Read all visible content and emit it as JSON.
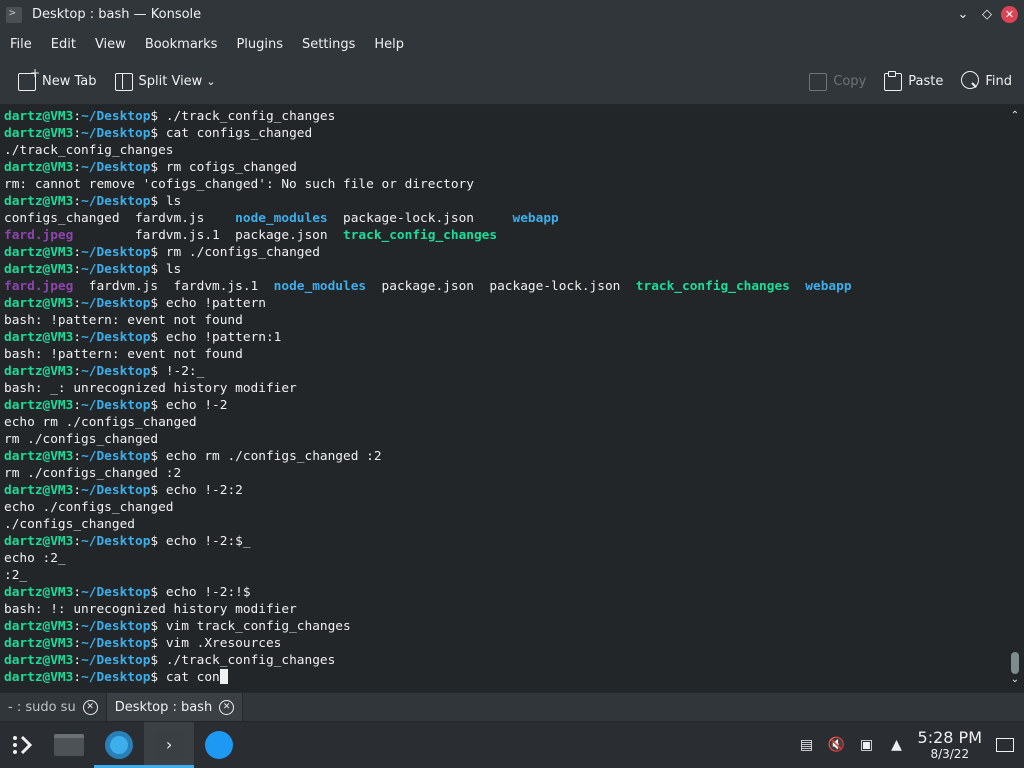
{
  "window": {
    "title": "Desktop : bash — Konsole"
  },
  "menu": [
    "File",
    "Edit",
    "View",
    "Bookmarks",
    "Plugins",
    "Settings",
    "Help"
  ],
  "toolbar": {
    "new_tab": "New Tab",
    "split_view": "Split View",
    "copy": "Copy",
    "paste": "Paste",
    "find": "Find"
  },
  "prompt": {
    "user": "dartz@VM3",
    "path": "~/Desktop"
  },
  "terminal": {
    "lines": [
      {
        "t": "p",
        "cmd": "./track_config_changes"
      },
      {
        "t": "p",
        "cmd": "cat configs_changed"
      },
      {
        "t": "o",
        "text": "./track_config_changes"
      },
      {
        "t": "p",
        "cmd": "rm cofigs_changed"
      },
      {
        "t": "o",
        "text": "rm: cannot remove 'cofigs_changed': No such file or directory"
      },
      {
        "t": "p",
        "cmd": "ls"
      },
      {
        "t": "ls",
        "items": [
          [
            "configs_changed  ",
            ""
          ],
          [
            "fardvm.js    ",
            ""
          ],
          [
            "node_modules",
            "dir"
          ],
          [
            "  package-lock.json     ",
            ""
          ],
          [
            "webapp",
            "dir"
          ]
        ]
      },
      {
        "t": "ls",
        "items": [
          [
            "fard.jpeg",
            "img"
          ],
          [
            "        fardvm.js.1  package.json  ",
            ""
          ],
          [
            "track_config_changes",
            "exe"
          ]
        ]
      },
      {
        "t": "p",
        "cmd": "rm ./configs_changed"
      },
      {
        "t": "p",
        "cmd": "ls"
      },
      {
        "t": "ls",
        "items": [
          [
            "fard.jpeg",
            "img"
          ],
          [
            "  fardvm.js  fardvm.js.1  ",
            ""
          ],
          [
            "node_modules",
            "dir"
          ],
          [
            "  package.json  package-lock.json  ",
            ""
          ],
          [
            "track_config_changes",
            "exe"
          ],
          [
            "  ",
            ""
          ],
          [
            "webapp",
            "dir"
          ]
        ]
      },
      {
        "t": "p",
        "cmd": "echo !pattern"
      },
      {
        "t": "o",
        "text": "bash: !pattern: event not found"
      },
      {
        "t": "p",
        "cmd": "echo !pattern:1"
      },
      {
        "t": "o",
        "text": "bash: !pattern: event not found"
      },
      {
        "t": "p",
        "cmd": "!-2:_"
      },
      {
        "t": "o",
        "text": "bash: _: unrecognized history modifier"
      },
      {
        "t": "p",
        "cmd": "echo !-2"
      },
      {
        "t": "o",
        "text": "echo rm ./configs_changed"
      },
      {
        "t": "o",
        "text": "rm ./configs_changed"
      },
      {
        "t": "p",
        "cmd": "echo rm ./configs_changed :2"
      },
      {
        "t": "o",
        "text": "rm ./configs_changed :2"
      },
      {
        "t": "p",
        "cmd": "echo !-2:2"
      },
      {
        "t": "o",
        "text": "echo ./configs_changed"
      },
      {
        "t": "o",
        "text": "./configs_changed"
      },
      {
        "t": "p",
        "cmd": "echo !-2:$_"
      },
      {
        "t": "o",
        "text": "echo :2_"
      },
      {
        "t": "o",
        "text": ":2_"
      },
      {
        "t": "p",
        "cmd": "echo !-2:!$"
      },
      {
        "t": "o",
        "text": "bash: !: unrecognized history modifier"
      },
      {
        "t": "p",
        "cmd": "vim track_config_changes"
      },
      {
        "t": "p",
        "cmd": "vim .Xresources"
      },
      {
        "t": "p",
        "cmd": "./track_config_changes"
      },
      {
        "t": "p",
        "cmd": "cat con",
        "cursor": true
      }
    ]
  },
  "tabs": [
    {
      "label": "- : sudo su",
      "active": false
    },
    {
      "label": "Desktop : bash",
      "active": true
    }
  ],
  "taskbar": {
    "time": "5:28 PM",
    "date": "8/3/22",
    "icons": [
      "launcher-icon",
      "file-manager-icon",
      "browser-icon",
      "konsole-icon",
      "discover-icon"
    ]
  },
  "colors": {
    "prompt_user": "#1cdc9a",
    "prompt_path": "#3daee9",
    "background": "#232629",
    "close": "#da4453"
  }
}
